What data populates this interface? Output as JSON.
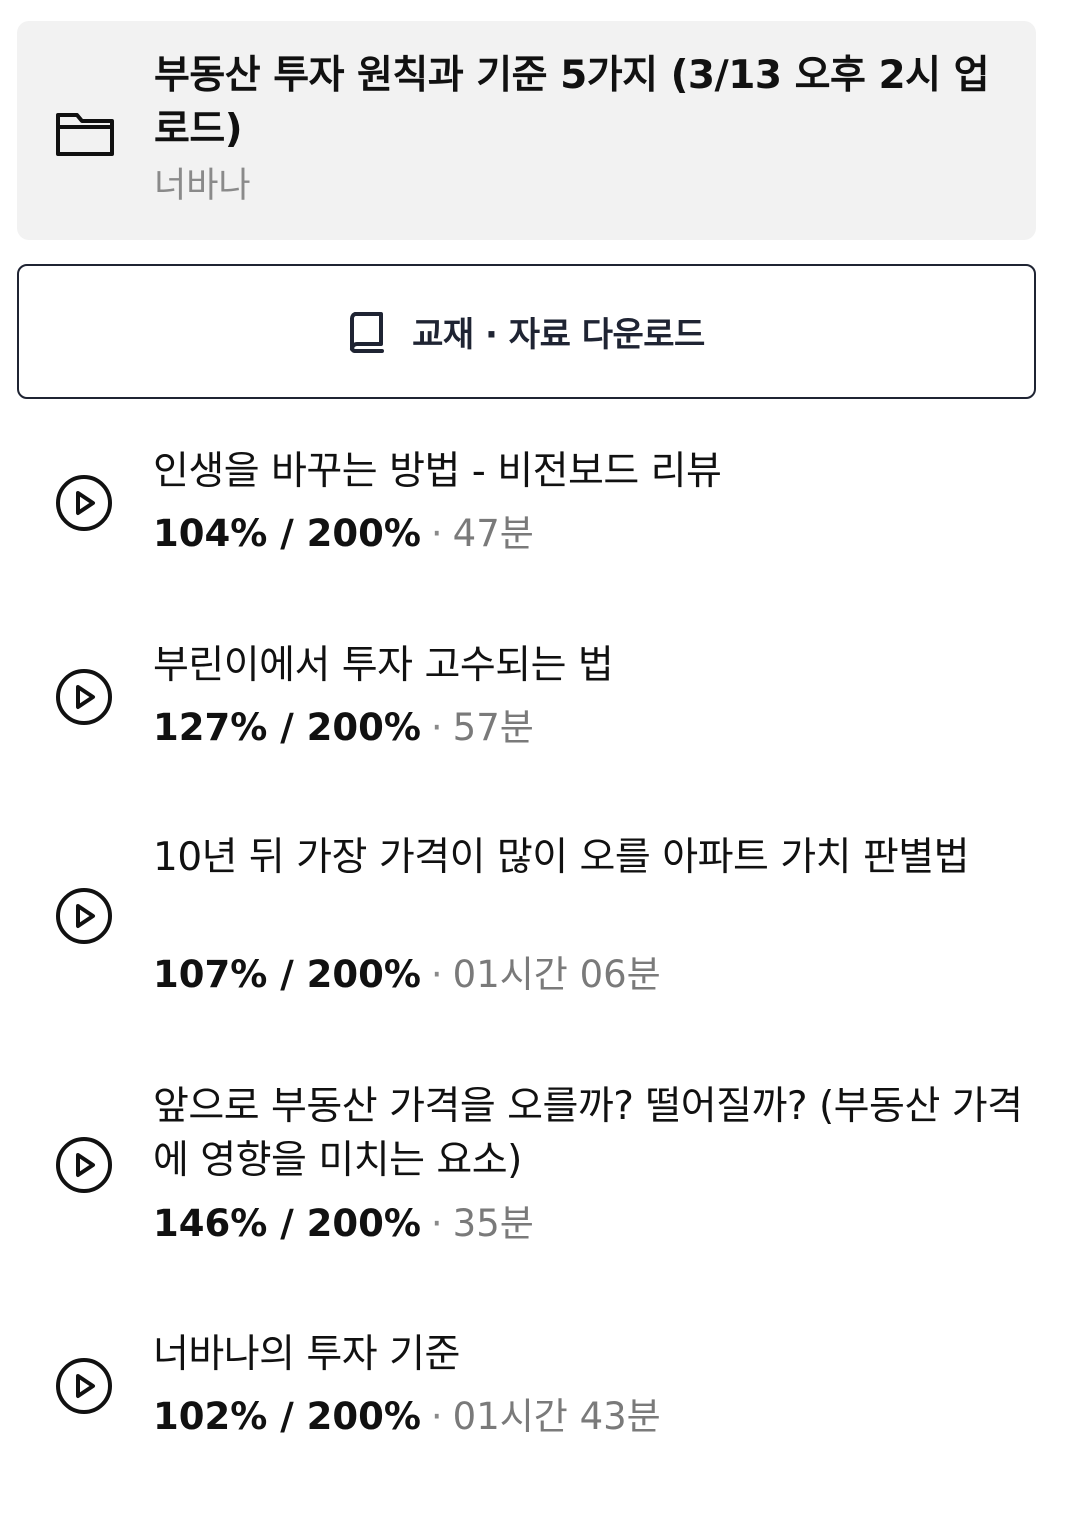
{
  "course": {
    "title": "부동산 투자 원칙과 기준 5가지 (3/13 오후 2시 업로드)",
    "author": "너바나",
    "icon": "folder-icon"
  },
  "download": {
    "label": "교재 · 자료 다운로드",
    "icon": "book-icon"
  },
  "lectures": [
    {
      "title": "인생을 바꾸는 방법 - 비전보드 리뷰",
      "progress": "104% / 200%",
      "separator": "·",
      "duration": "47분"
    },
    {
      "title": "부린이에서 투자 고수되는 법",
      "progress": "127% / 200%",
      "separator": "·",
      "duration": "57분"
    },
    {
      "title": "10년 뒤 가장 가격이 많이 오를 아파트 가치 판별법",
      "progress": "107% / 200%",
      "separator": "·",
      "duration": "01시간 06분"
    },
    {
      "title": "앞으로 부동산 가격을 오를까? 떨어질까? (부동산 가격에 영향을 미치는 요소)",
      "progress": "146% / 200%",
      "separator": "·",
      "duration": "35분"
    },
    {
      "title": "너바나의 투자 기준",
      "progress": "102% / 200%",
      "separator": "·",
      "duration": "01시간 43분"
    }
  ],
  "colors": {
    "header_bg": "#f2f2f2",
    "button_border": "#1f2433",
    "muted_text": "#8a8a8a"
  }
}
